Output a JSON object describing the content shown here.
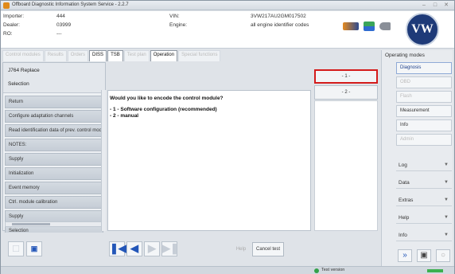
{
  "window": {
    "title": "Offboard Diagnostic Information System Service - 2.2.7"
  },
  "header": {
    "importer_label": "Importer:",
    "importer_value": "444",
    "dealer_label": "Dealer:",
    "dealer_value": "03999",
    "ro_label": "RO:",
    "ro_value": "---",
    "vin_label": "VIN:",
    "vin_value": "3VW217AU2GM017502",
    "engine_label": "Engine:",
    "engine_value": "all engine identifier codes",
    "logo_text": "VW"
  },
  "tabs": [
    {
      "label": "Control modules",
      "active": false
    },
    {
      "label": "Results",
      "active": false
    },
    {
      "label": "Orders",
      "active": false
    },
    {
      "label": "DISS",
      "active": true
    },
    {
      "label": "TSB",
      "active": true
    },
    {
      "label": "Test plan",
      "active": false
    },
    {
      "label": "Operation",
      "active": true
    },
    {
      "label": "Special functions",
      "active": false
    }
  ],
  "selection_panel": {
    "line1": "J764 Replace",
    "line2": "Selection"
  },
  "nav_items": [
    "Return",
    "Configure adaptation channels",
    "Read identification data of prev. control module",
    "NOTES:",
    "Supply",
    "Initialization",
    "Event memory",
    "Ctrl. module calibration",
    "Supply",
    "Selection"
  ],
  "content": {
    "question": "Would you like to encode the control module?",
    "option1": "- 1 - Software configuration (recommended)",
    "option2": "- 2 - manual"
  },
  "option_buttons": [
    "- 1 -",
    "- 2 -"
  ],
  "bottom": {
    "help_label": "Help",
    "cancel_label": "Cancel test"
  },
  "right_panel": {
    "heading": "Operating modes",
    "modes": [
      "Diagnosis",
      "OBD",
      "Flash",
      "Measurement",
      "Info",
      "Admin"
    ],
    "menus": [
      "Log",
      "Data",
      "Extras",
      "Help",
      "Info"
    ]
  },
  "status": {
    "version": "Test version"
  }
}
